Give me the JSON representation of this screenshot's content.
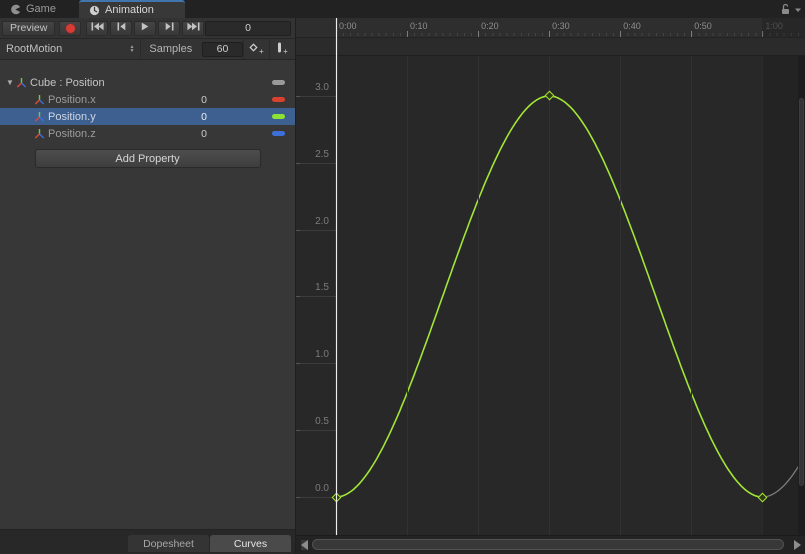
{
  "window": {
    "tabs": [
      {
        "label": "Game"
      },
      {
        "label": "Animation",
        "active": true
      }
    ]
  },
  "toolbar": {
    "preview_label": "Preview",
    "frame_value": "0"
  },
  "controls_row": {
    "clip_popup_value": "RootMotion",
    "samples_label": "Samples",
    "samples_value": "60"
  },
  "properties": {
    "group_label": "Cube : Position",
    "group_pill_color": "#9a9a9a",
    "rows": [
      {
        "name": "Position.x",
        "value": "0",
        "color": "#d8412f",
        "selected": false
      },
      {
        "name": "Position.y",
        "value": "0",
        "color": "#8de334",
        "selected": true
      },
      {
        "name": "Position.z",
        "value": "0",
        "color": "#3d6fd8",
        "selected": false
      }
    ],
    "add_property_label": "Add Property"
  },
  "bottom_tabs": {
    "dopesheet_label": "Dopesheet",
    "curves_label": "Curves"
  },
  "colors": {
    "selection": "#3d6091",
    "curve": "#a2e636",
    "extrapolation": "#8f8f8f",
    "record": "#d83b34",
    "playhead": "#eeeeee"
  },
  "chart_data": {
    "type": "line",
    "title": "Position.y animation curve",
    "x_tick_labels": [
      "0:00",
      "0:10",
      "0:20",
      "0:30",
      "0:40",
      "0:50",
      "1:00"
    ],
    "x_tick_frames": [
      0,
      10,
      20,
      30,
      40,
      50,
      60
    ],
    "y_tick_labels": [
      "3.0",
      "2.5",
      "2.0",
      "1.5",
      "1.0",
      "0.5",
      "0.0"
    ],
    "y_tick_values": [
      3.0,
      2.5,
      2.0,
      1.5,
      1.0,
      0.5,
      0.0
    ],
    "clip_end_frame": 60,
    "samples_per_second": 60,
    "playhead_frame": 0,
    "legend": "none",
    "grid": "vertical-only",
    "series": [
      {
        "name": "Position.y",
        "color": "#a2e636",
        "interpolation": "smooth",
        "keyframes": [
          {
            "time": "0:00",
            "frame": 0,
            "value": 0
          },
          {
            "time": "0:30",
            "frame": 30,
            "value": 3
          },
          {
            "time": "1:00",
            "frame": 60,
            "value": 0
          }
        ]
      }
    ]
  }
}
